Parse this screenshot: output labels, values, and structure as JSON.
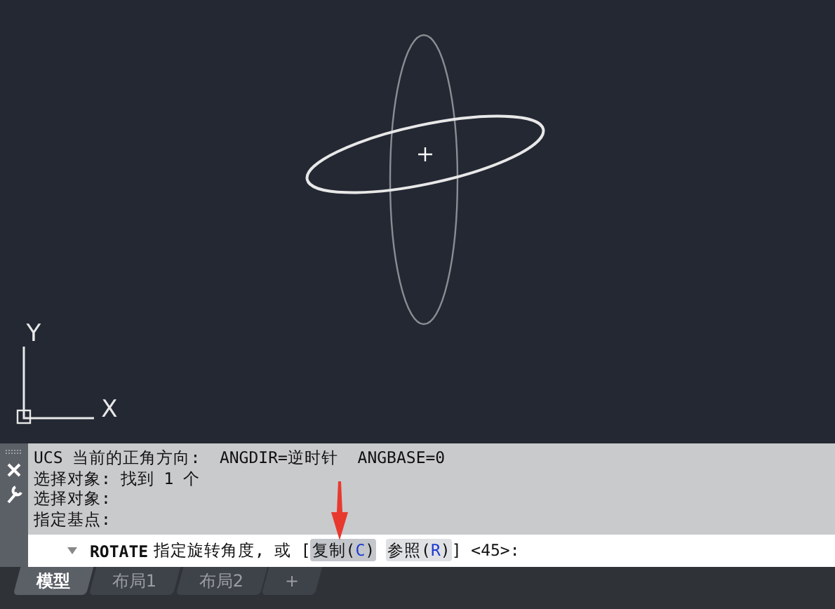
{
  "canvas": {
    "ucs": {
      "x_label": "X",
      "y_label": "Y"
    }
  },
  "command_history": [
    "UCS 当前的正角方向:  ANGDIR=逆时针  ANGBASE=0",
    "选择对象: 找到 1 个",
    "选择对象:",
    "指定基点:"
  ],
  "command_line": {
    "command": "ROTATE",
    "prompt": "指定旋转角度, 或 [",
    "options": [
      {
        "before": "复制(",
        "key": "C",
        "after": ")",
        "highlighted": true
      },
      {
        "before": "参照(",
        "key": "R",
        "after": ")",
        "highlighted": false
      }
    ],
    "tail": "] <45>:"
  },
  "tabs": [
    {
      "label": "模型",
      "selected": true
    },
    {
      "label": "布局1",
      "selected": false
    },
    {
      "label": "布局2",
      "selected": false
    }
  ],
  "add_tab": "+"
}
